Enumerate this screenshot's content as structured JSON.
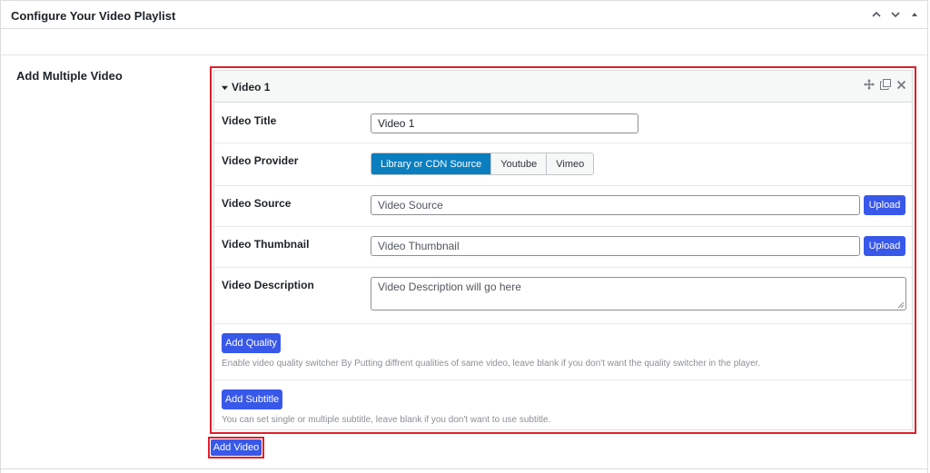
{
  "panel": {
    "title": "Configure Your Video Playlist"
  },
  "section": {
    "label": "Add Multiple Video"
  },
  "video": {
    "heading": "Video 1",
    "title_label": "Video Title",
    "title_value": "Video 1",
    "provider_label": "Video Provider",
    "providers": [
      "Library or CDN Source",
      "Youtube",
      "Vimeo"
    ],
    "source_label": "Video Source",
    "source_placeholder": "Video Source",
    "thumbnail_label": "Video Thumbnail",
    "thumbnail_placeholder": "Video Thumbnail",
    "upload_label": "Upload",
    "description_label": "Video Description",
    "description_placeholder": "Video Description will go here",
    "add_quality_label": "Add Quality",
    "quality_hint": "Enable video quality switcher By Putting diffrent qualities of same video, leave blank if you don't want the quality switcher in the player.",
    "add_subtitle_label": "Add Subtitle",
    "subtitle_hint": "You can set single or multiple subtitle, leave blank if you don't want to use subtitle."
  },
  "footer": {
    "add_video_label": "Add Video"
  },
  "colors": {
    "accent_blue": "#3858e9",
    "active_segment": "#0a7ebf",
    "highlight_red": "#e01e2a"
  }
}
